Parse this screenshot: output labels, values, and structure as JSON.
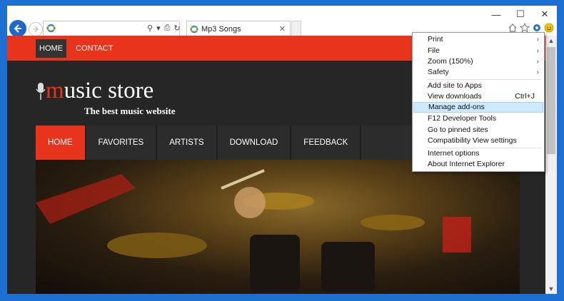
{
  "browser": {
    "tab_title": "Mp3 Songs",
    "window_controls": {
      "minimize": "—",
      "maximize": "☐",
      "close": "✕"
    }
  },
  "menu": {
    "items": [
      {
        "label": "Print",
        "has_submenu": true
      },
      {
        "label": "File",
        "has_submenu": true
      },
      {
        "label": "Zoom (150%)",
        "has_submenu": true
      },
      {
        "label": "Safety",
        "has_submenu": true
      },
      {
        "label": "Add site to Apps"
      },
      {
        "label": "View downloads",
        "shortcut": "Ctrl+J"
      },
      {
        "label": "Manage add-ons",
        "highlighted": true
      },
      {
        "label": "F12 Developer Tools"
      },
      {
        "label": "Go to pinned sites"
      },
      {
        "label": "Compatibility View settings"
      },
      {
        "label": "Internet options"
      },
      {
        "label": "About Internet Explorer"
      }
    ]
  },
  "site": {
    "top_links": [
      "HOME",
      "CONTACT"
    ],
    "logo_prefix": "m",
    "logo_rest": "usic store",
    "tagline": "The best music website",
    "nav": [
      "HOME",
      "FAVORITES",
      "ARTISTS",
      "DOWNLOAD",
      "FEEDBACK"
    ],
    "accent": "#e8341c"
  }
}
